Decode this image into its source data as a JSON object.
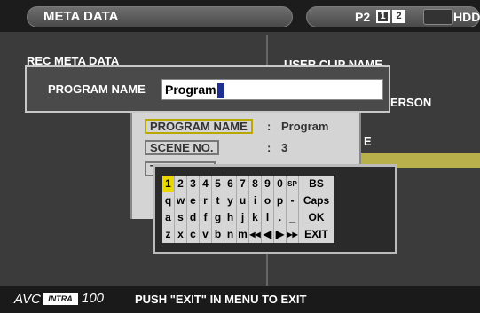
{
  "header": {
    "title": "META DATA",
    "card_format": "P2",
    "slots": [
      "1",
      "2"
    ],
    "drive": "HDD"
  },
  "left_section": {
    "label": "REC META DATA"
  },
  "right_section": {
    "label": "USER CLIP NAME",
    "partial_text_1": "ERSON",
    "partial_text_2": "E"
  },
  "program_dialog": {
    "label": "PROGRAM NAME",
    "value": "Program"
  },
  "meta_fields": [
    {
      "label": "PROGRAM NAME",
      "separator": ":",
      "value": "Program",
      "selected": true
    },
    {
      "label": "SCENE NO.",
      "separator": ":",
      "value": "3",
      "selected": false
    },
    {
      "label": "T",
      "separator": "",
      "value": "",
      "selected": false
    }
  ],
  "keyboard": {
    "rows": [
      [
        "1",
        "2",
        "3",
        "4",
        "5",
        "6",
        "7",
        "8",
        "9",
        "0",
        "SP",
        "BS"
      ],
      [
        "q",
        "w",
        "e",
        "r",
        "t",
        "y",
        "u",
        "i",
        "o",
        "p",
        "-",
        "Caps"
      ],
      [
        "a",
        "s",
        "d",
        "f",
        "g",
        "h",
        "j",
        "k",
        "l",
        ".",
        "_",
        "OK"
      ],
      [
        "z",
        "x",
        "c",
        "v",
        "b",
        "n",
        "m",
        "◀◀",
        "◀",
        "▶",
        "▶▶",
        "EXIT"
      ]
    ],
    "selected_key": "1"
  },
  "footer": {
    "logo_left": "AVC",
    "logo_badge": "INTRA",
    "logo_right": "100",
    "hint": "PUSH \"EXIT\" IN MENU TO EXIT"
  },
  "colors": {
    "selection": "#e8d800",
    "highlight_bar": "#b8b04a",
    "cursor": "#1f2f8f"
  }
}
